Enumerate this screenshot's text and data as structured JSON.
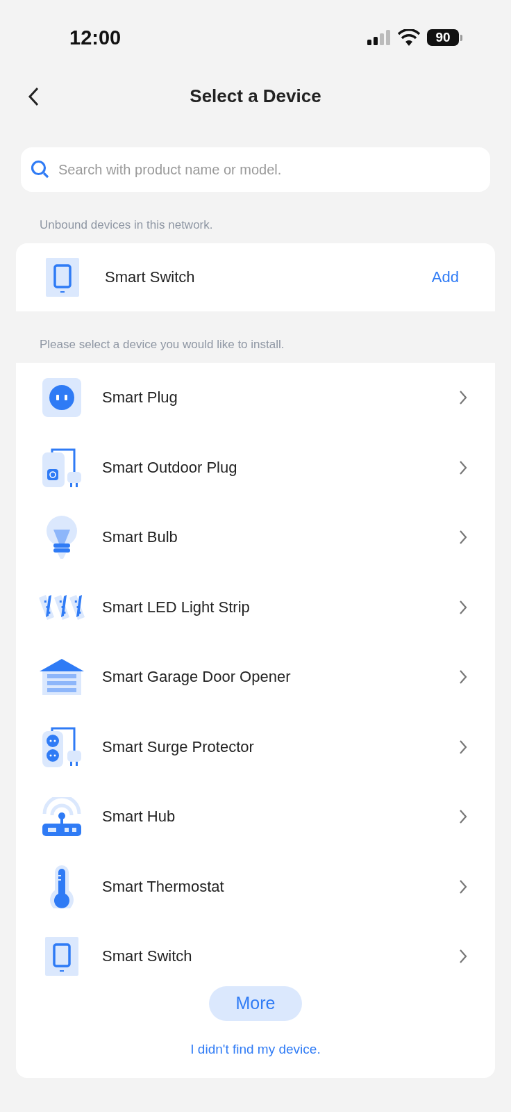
{
  "status_bar": {
    "time": "12:00",
    "battery": "90"
  },
  "header": {
    "title": "Select a Device"
  },
  "search": {
    "placeholder": "Search with product name or model."
  },
  "unbound": {
    "label": "Unbound devices in this network.",
    "items": [
      {
        "kind": "switch",
        "name": "Smart Switch",
        "action": "Add"
      }
    ]
  },
  "catalog": {
    "label": "Please select a device you would like to install.",
    "items": [
      {
        "kind": "plug",
        "name": "Smart Plug"
      },
      {
        "kind": "outdoor-plug",
        "name": "Smart Outdoor Plug"
      },
      {
        "kind": "bulb",
        "name": "Smart Bulb"
      },
      {
        "kind": "light-strip",
        "name": "Smart LED Light Strip"
      },
      {
        "kind": "garage",
        "name": "Smart Garage Door Opener"
      },
      {
        "kind": "surge",
        "name": "Smart Surge Protector"
      },
      {
        "kind": "hub",
        "name": "Smart Hub"
      },
      {
        "kind": "thermostat",
        "name": "Smart Thermostat"
      },
      {
        "kind": "switch",
        "name": "Smart Switch"
      }
    ],
    "more": "More",
    "not_found": "I didn't find my device."
  }
}
